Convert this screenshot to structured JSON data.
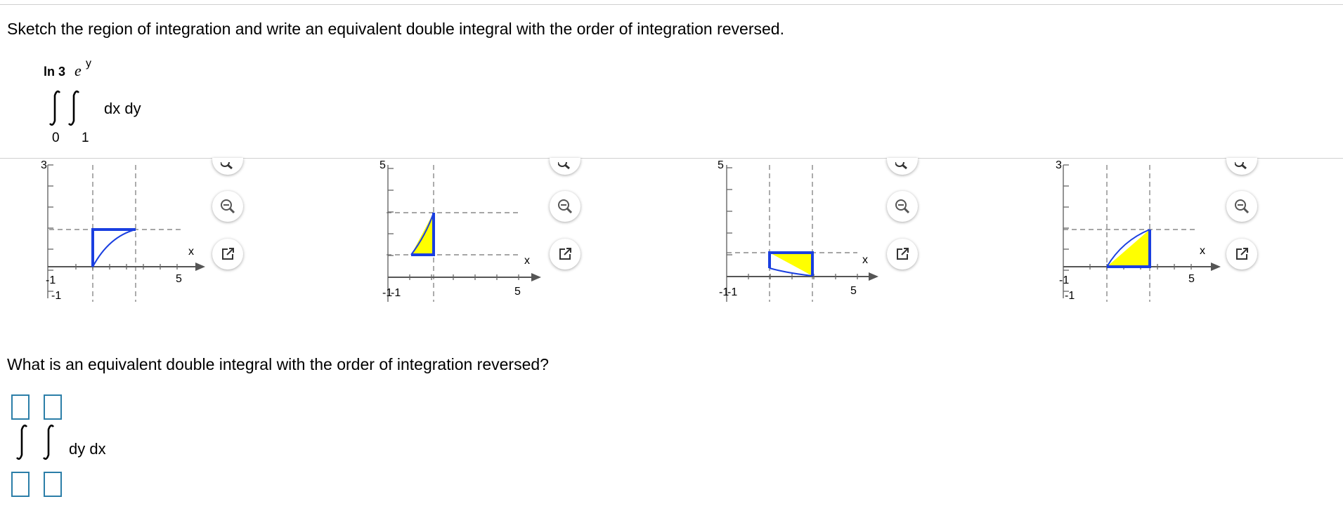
{
  "question": "Sketch the region of integration and write an equivalent double integral with the order of integration reversed.",
  "given_integral": {
    "outer_upper": "ln 3",
    "inner_upper_base": "e",
    "inner_upper_exp": "y",
    "outer_lower": "0",
    "inner_lower": "1",
    "differentials": "dx dy"
  },
  "graphs": [
    {
      "ytick_top": "3",
      "xtick_right": "5",
      "xneg": "-1",
      "yneg": "-1",
      "xlabel": "x"
    },
    {
      "ytick_top": "5",
      "xtick_right": "5",
      "xneg": "-1",
      "yneg": "-1",
      "xlabel": "x"
    },
    {
      "ytick_top": "5",
      "xtick_right": "5",
      "xneg": "-1",
      "yneg": "-1",
      "xlabel": "x"
    },
    {
      "ytick_top": "3",
      "xtick_right": "5",
      "xneg": "-1",
      "yneg": "-1",
      "xlabel": "x"
    }
  ],
  "tools": {
    "zoom_icon": "magnifier-icon",
    "popout_icon": "external-link-icon"
  },
  "answer_question": "What is an equivalent double integral with the order of integration reversed?",
  "answer_integral": {
    "differentials": "dy dx"
  },
  "colors": {
    "fill": "#ffff00",
    "outline": "#1a3fe0",
    "box_border": "#2b7ea8"
  }
}
